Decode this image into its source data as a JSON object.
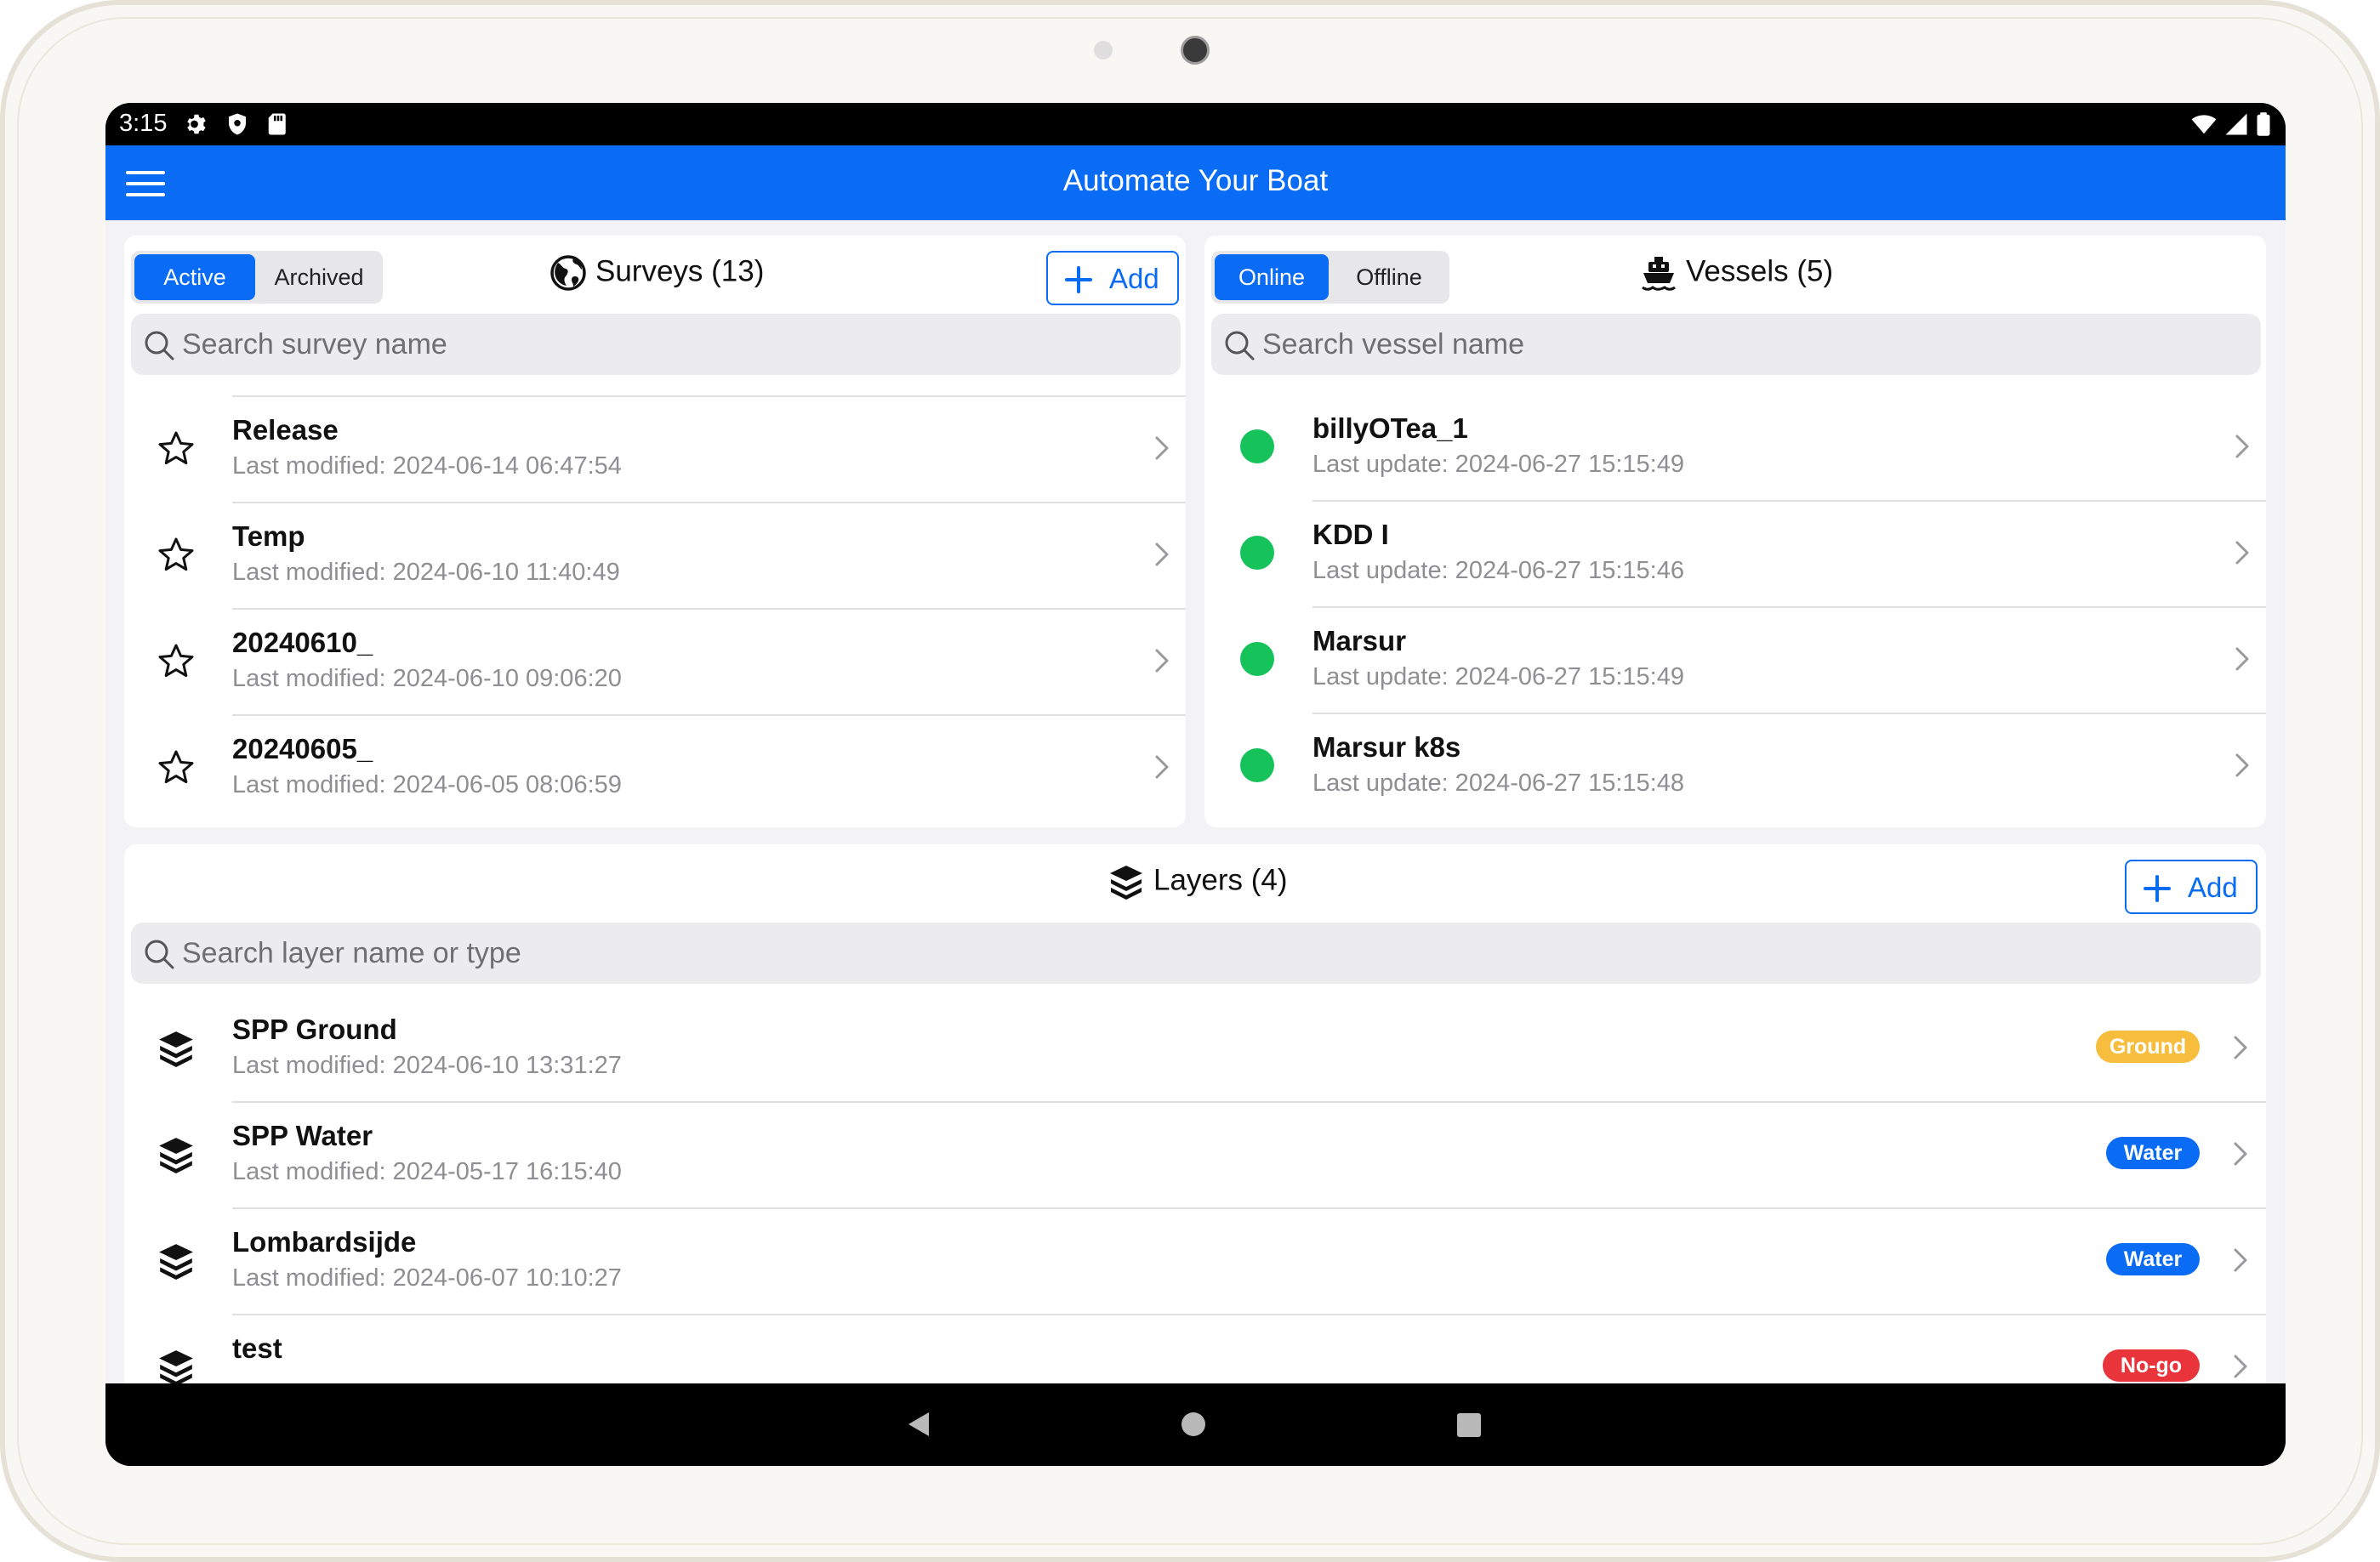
{
  "status": {
    "time": "3:15"
  },
  "app": {
    "title": "Automate Your Boat"
  },
  "surveys": {
    "tabs": [
      "Active",
      "Archived"
    ],
    "title": "Surveys (13)",
    "add_label": "Add",
    "search_placeholder": "Search survey name",
    "items": [
      {
        "name": "Release",
        "sub": "Last modified: 2024-06-14 06:47:54"
      },
      {
        "name": "Temp",
        "sub": "Last modified: 2024-06-10 11:40:49"
      },
      {
        "name": "20240610_",
        "sub": "Last modified: 2024-06-10 09:06:20"
      },
      {
        "name": "20240605_",
        "sub": "Last modified: 2024-06-05 08:06:59"
      }
    ]
  },
  "vessels": {
    "tabs": [
      "Online",
      "Offline"
    ],
    "title": "Vessels (5)",
    "search_placeholder": "Search vessel name",
    "items": [
      {
        "name": "billyOTea_1",
        "sub": "Last update: 2024-06-27 15:15:49"
      },
      {
        "name": "KDD I",
        "sub": "Last update: 2024-06-27 15:15:46"
      },
      {
        "name": "Marsur",
        "sub": "Last update: 2024-06-27 15:15:49"
      },
      {
        "name": "Marsur k8s",
        "sub": "Last update: 2024-06-27 15:15:48"
      }
    ]
  },
  "layers": {
    "title": "Layers (4)",
    "add_label": "Add",
    "search_placeholder": "Search layer name or type",
    "items": [
      {
        "name": "SPP Ground",
        "sub": "Last modified: 2024-06-10 13:31:27",
        "badge": "Ground",
        "badge_color": "#f7be3e"
      },
      {
        "name": "SPP Water",
        "sub": "Last modified: 2024-05-17 16:15:40",
        "badge": "Water",
        "badge_color": "#0a6cf5"
      },
      {
        "name": "Lombardsijde",
        "sub": "Last modified: 2024-06-07 10:10:27",
        "badge": "Water",
        "badge_color": "#0a6cf5"
      },
      {
        "name": "test",
        "sub": "",
        "badge": "No-go",
        "badge_color": "#e8343a"
      }
    ]
  },
  "colors": {
    "accent": "#0a6cf5",
    "online": "#16c35a",
    "ground": "#f7be3e",
    "water": "#0a6cf5",
    "nogo": "#e8343a"
  }
}
